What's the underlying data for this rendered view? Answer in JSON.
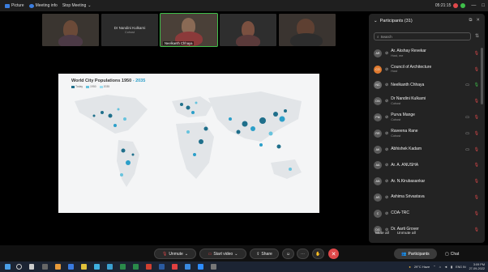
{
  "topbar": {
    "items": [
      "Picture",
      "Meeting info",
      "Stop Meeting"
    ],
    "clock": "05:21:15"
  },
  "video_strip": [
    {
      "name": ""
    },
    {
      "name": "Dr Nandini Kulkarni",
      "role": "Cohost",
      "no_video": true
    },
    {
      "name": "Neelkanth Chhaya",
      "active": true
    },
    {
      "name": ""
    },
    {
      "name": ""
    }
  ],
  "shared_screen": {
    "title_main": "World City Populations 1950",
    "title_accent": "- 2035",
    "legend": [
      "Today",
      "1950",
      "2035"
    ],
    "accent_color": "#2b9fc9"
  },
  "participants": {
    "header": "Participants (31)",
    "search_placeholder": "Search",
    "list": [
      {
        "initials": "AR",
        "name": "Ar. Akshay Revekar",
        "role": "Host, me",
        "avatar_color": "#5a5a5a"
      },
      {
        "initials": "CO",
        "name": "Council of Architecture",
        "role": "Host",
        "avatar_color": "#e07a2f"
      },
      {
        "initials": "NC",
        "name": "Neelkanth Chhaya",
        "role": "",
        "avatar_color": "#6a6a6a"
      },
      {
        "initials": "DN",
        "name": "Dr Nandini Kulkarni",
        "role": "Cohost",
        "avatar_color": "#5a5a5a"
      },
      {
        "initials": "PM",
        "name": "Purva Mange",
        "role": "Cohost",
        "avatar_color": "#5a5a5a"
      },
      {
        "initials": "RR",
        "name": "Raveena Rane",
        "role": "Cohost",
        "avatar_color": "#5a5a5a"
      },
      {
        "initials": "AK",
        "name": "Abhishek Kadam",
        "role": "",
        "avatar_color": "#5a5a5a"
      },
      {
        "initials": "AA",
        "name": "Ar. A. ANUSHA",
        "role": "",
        "avatar_color": "#5a5a5a"
      },
      {
        "initials": "AN",
        "name": "Ar. N.Kirubasankar",
        "role": "",
        "avatar_color": "#5a5a5a"
      },
      {
        "initials": "AS",
        "name": "Ashima Srivastava",
        "role": "",
        "avatar_color": "#5a5a5a"
      },
      {
        "initials": "C",
        "name": "COA-TRC",
        "role": "",
        "avatar_color": "#5a5a5a"
      },
      {
        "initials": "DG",
        "name": "Dr. Aarti Grover",
        "role": "",
        "avatar_color": "#5a5a5a"
      }
    ],
    "mute_all": "Mute all",
    "unmute_all": "Unmute all"
  },
  "controls": {
    "unmute": "Unmute",
    "start_video": "Start video",
    "share": "Share",
    "participants": "Participants",
    "chat": "Chat"
  },
  "taskbar": {
    "weather": "29°C Haze",
    "lang": "ENG IN",
    "time": "3:09 PM",
    "date": "27-09-2022"
  }
}
